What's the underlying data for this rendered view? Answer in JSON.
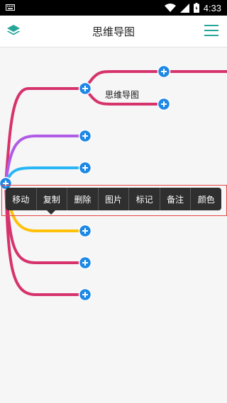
{
  "status_bar": {
    "time": "4:33",
    "icons": [
      "keyboard-icon",
      "wifi-icon",
      "signal-icon",
      "battery-icon"
    ]
  },
  "app_bar": {
    "title": "思维导图",
    "left_icon": "layers-icon",
    "right_icon": "menu-icon",
    "accent_color": "#26a69a"
  },
  "mindmap": {
    "node_label": "思维导图",
    "branch_colors": [
      "#d6336c",
      "#b05ce6",
      "#29b6f6",
      "#ffc107",
      "#d6336c",
      "#d6336c"
    ],
    "add_button_color": "#1e88e5"
  },
  "context_menu": {
    "items": [
      "移动",
      "复制",
      "删除",
      "图片",
      "标记",
      "备注",
      "颜色"
    ]
  }
}
